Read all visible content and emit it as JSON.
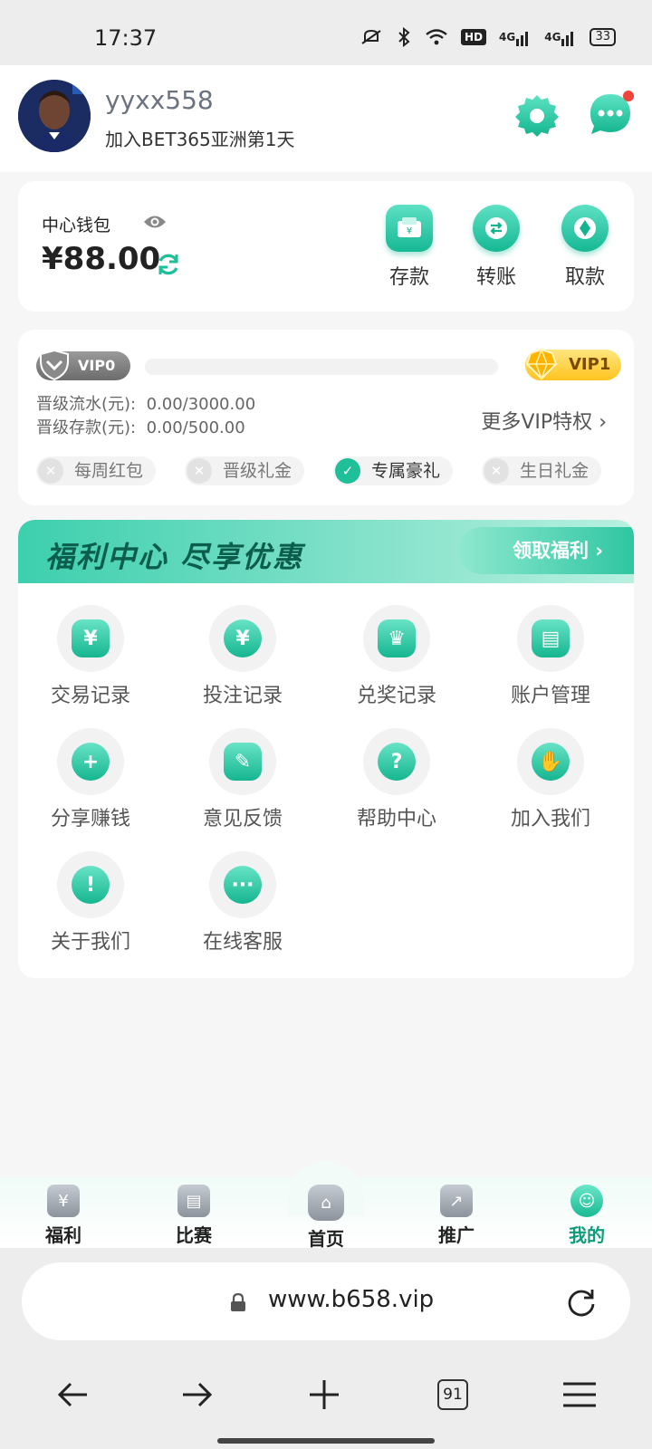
{
  "status_bar": {
    "time": "17:37",
    "network_hd": "HD",
    "network_1": "4G",
    "network_2": "4G",
    "battery": "33"
  },
  "profile": {
    "username": "yyxx558",
    "join_text": "加入BET365亚洲第1天"
  },
  "wallet": {
    "label": "中心钱包",
    "balance": "¥88.00",
    "actions": [
      {
        "label": "存款",
        "icon": "wallet-icon"
      },
      {
        "label": "转账",
        "icon": "transfer-icon"
      },
      {
        "label": "取款",
        "icon": "withdraw-icon"
      }
    ]
  },
  "vip": {
    "current_level": "VIP0",
    "next_level": "VIP1",
    "turnover_label": "晋级流水(元):",
    "turnover_value": "0.00/3000.00",
    "deposit_label": "晋级存款(元):",
    "deposit_value": "0.00/500.00",
    "more_link": "更多VIP特权",
    "progress": 0,
    "perks": [
      {
        "label": "每周红包",
        "active": false
      },
      {
        "label": "晋级礼金",
        "active": false
      },
      {
        "label": "专属豪礼",
        "active": true
      },
      {
        "label": "生日礼金",
        "active": false
      }
    ]
  },
  "benefits": {
    "banner_title": "福利中心 尽享优惠",
    "banner_action": "领取福利",
    "items": [
      {
        "label": "交易记录",
        "icon": "transaction-record-icon"
      },
      {
        "label": "投注记录",
        "icon": "bet-record-icon"
      },
      {
        "label": "兑奖记录",
        "icon": "prize-record-icon"
      },
      {
        "label": "账户管理",
        "icon": "account-management-icon"
      },
      {
        "label": "分享赚钱",
        "icon": "share-earn-icon"
      },
      {
        "label": "意见反馈",
        "icon": "feedback-icon"
      },
      {
        "label": "帮助中心",
        "icon": "help-icon"
      },
      {
        "label": "加入我们",
        "icon": "join-us-icon"
      },
      {
        "label": "关于我们",
        "icon": "about-icon"
      },
      {
        "label": "在线客服",
        "icon": "customer-service-icon"
      }
    ]
  },
  "tabbar": {
    "tabs": [
      {
        "label": "福利",
        "icon": "benefits-tab-icon"
      },
      {
        "label": "比赛",
        "icon": "matches-tab-icon"
      },
      {
        "label": "首页",
        "icon": "home-tab-icon"
      },
      {
        "label": "推广",
        "icon": "promote-tab-icon"
      },
      {
        "label": "我的",
        "icon": "profile-tab-icon",
        "active": true
      }
    ]
  },
  "browser": {
    "url": "www.b658.vip",
    "tab_count": "91"
  },
  "colors": {
    "accent": "#1fbf9a",
    "accent_dark": "#0b5e4c",
    "vip_gold": "#ffc41f",
    "notification": "#f04438"
  }
}
